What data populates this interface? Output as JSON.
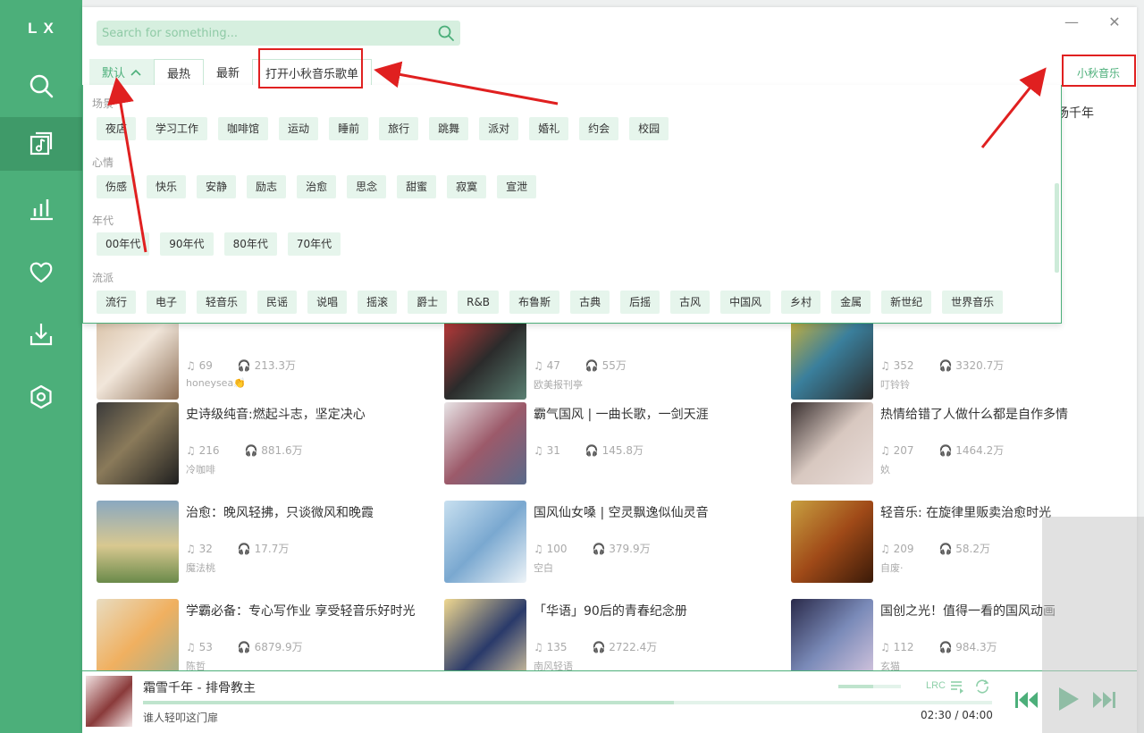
{
  "app": {
    "logo": "LX"
  },
  "sidebar": {
    "items": [
      {
        "icon": "search-icon",
        "label": "search"
      },
      {
        "icon": "songlist-icon",
        "label": "songlist",
        "active": true
      },
      {
        "icon": "leaderboard-icon",
        "label": "leaderboard"
      },
      {
        "icon": "heart-icon",
        "label": "favorites"
      },
      {
        "icon": "download-icon",
        "label": "download"
      },
      {
        "icon": "settings-icon",
        "label": "settings"
      }
    ]
  },
  "search": {
    "placeholder": "Search for something..."
  },
  "window": {
    "minimize": "—",
    "close": "✕"
  },
  "tabs": {
    "default_label": "默认",
    "items": [
      "最热",
      "最新"
    ],
    "open_list_label": "打开小秋音乐歌单",
    "source_label": "小秋音乐"
  },
  "tag_groups": [
    {
      "title": "场景",
      "tags": [
        "夜店",
        "学习工作",
        "咖啡馆",
        "运动",
        "睡前",
        "旅行",
        "跳舞",
        "派对",
        "婚礼",
        "约会",
        "校园"
      ]
    },
    {
      "title": "心情",
      "tags": [
        "伤感",
        "快乐",
        "安静",
        "励志",
        "治愈",
        "思念",
        "甜蜜",
        "寂寞",
        "宣泄"
      ]
    },
    {
      "title": "年代",
      "tags": [
        "00年代",
        "90年代",
        "80年代",
        "70年代"
      ]
    },
    {
      "title": "流派",
      "tags": [
        "流行",
        "电子",
        "轻音乐",
        "民谣",
        "说唱",
        "摇滚",
        "爵士",
        "R&B",
        "布鲁斯",
        "古典",
        "后摇",
        "古风",
        "中国风",
        "乡村",
        "金属",
        "新世纪",
        "世界音乐"
      ]
    }
  ],
  "partial_text": "场千年",
  "songlists": [
    {
      "name": "",
      "songs": "69",
      "plays": "213.3万",
      "author": "honeysea👏"
    },
    {
      "name": "",
      "songs": "47",
      "plays": "55万",
      "author": "欧美报刊亭"
    },
    {
      "name": "",
      "songs": "352",
      "plays": "3320.7万",
      "author": "叮铃铃"
    },
    {
      "name": "史诗级纯音:燃起斗志，坚定决心",
      "songs": "216",
      "plays": "881.6万",
      "author": "冷咖啡"
    },
    {
      "name": "霸气国风 | 一曲长歌，一剑天涯",
      "songs": "31",
      "plays": "145.8万",
      "author": ""
    },
    {
      "name": "热情给错了人做什么都是自作多情",
      "songs": "207",
      "plays": "1464.2万",
      "author": "奺"
    },
    {
      "name": "治愈：晚风轻拂，只谈微风和晚霞",
      "songs": "32",
      "plays": "17.7万",
      "author": "魔法桃"
    },
    {
      "name": "国风仙女嗓 | 空灵飘逸似仙灵音",
      "songs": "100",
      "plays": "379.9万",
      "author": "空白"
    },
    {
      "name": "轻音乐: 在旋律里贩卖治愈时光",
      "songs": "209",
      "plays": "58.2万",
      "author": "自废·"
    },
    {
      "name": "学霸必备：专心写作业 享受轻音乐好时光",
      "songs": "53",
      "plays": "6879.9万",
      "author": "陈哲"
    },
    {
      "name": "「华语」90后的青春纪念册",
      "songs": "135",
      "plays": "2722.4万",
      "author": "南风轻语"
    },
    {
      "name": "国创之光！值得一看的国风动画",
      "songs": "112",
      "plays": "984.3万",
      "author": "玄猫"
    }
  ],
  "player": {
    "title": "霜雪千年 - 排骨教主",
    "lyric": "谁人轻叩这门扉",
    "time": "02:30 / 04:00",
    "lrc_label": "LRC",
    "progress": 0.625,
    "volume": 0.55
  },
  "colors": {
    "accent": "#4caf7a",
    "tag_bg": "#e6f5ec",
    "highlight": "#e02020"
  }
}
